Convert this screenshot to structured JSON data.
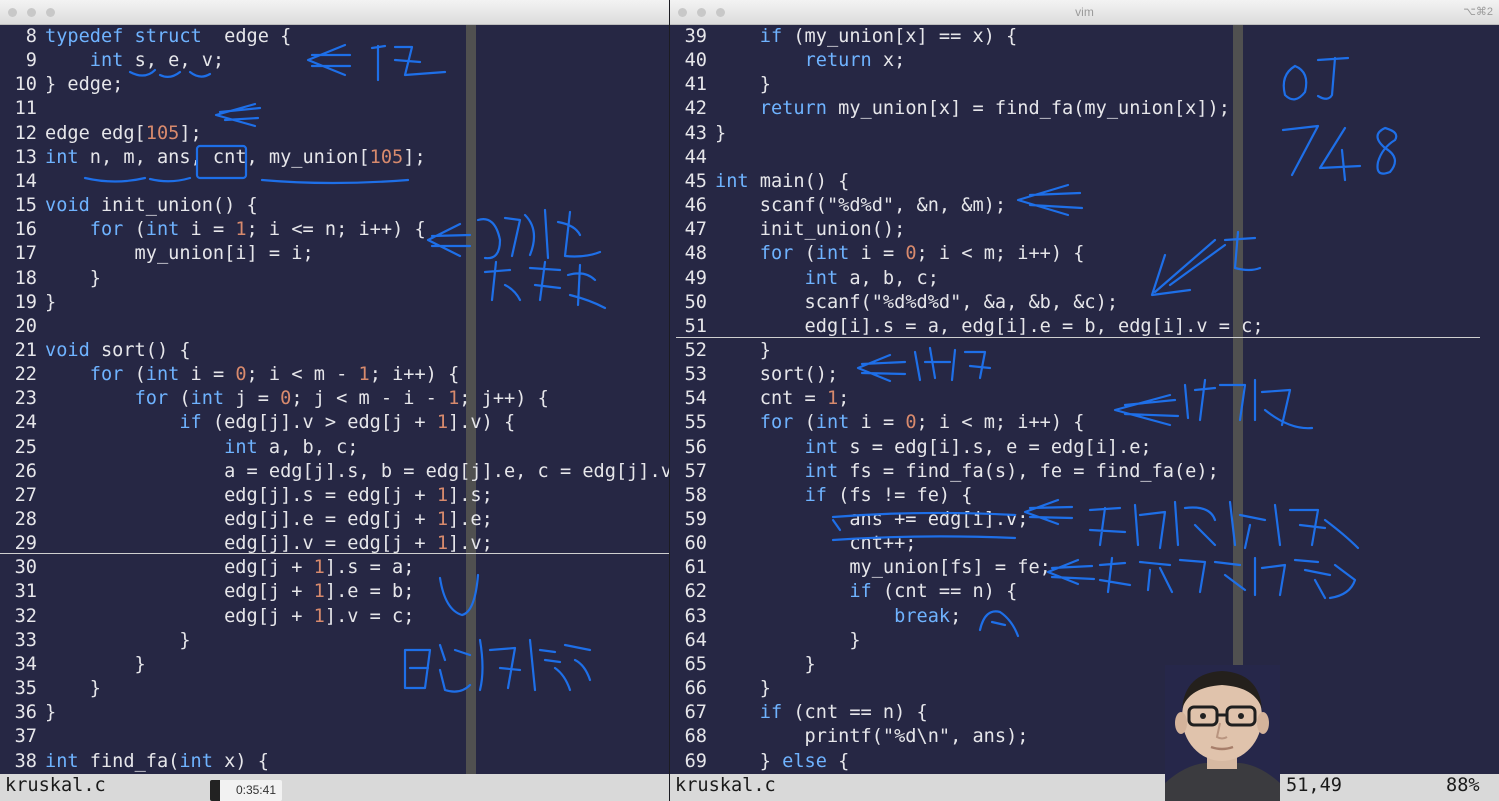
{
  "left_pane": {
    "status_file": "kruskal.c",
    "lines": [
      {
        "n": "8",
        "parts": [
          [
            "kw",
            "typedef struct"
          ],
          [
            "",
            "  edge {"
          ]
        ]
      },
      {
        "n": "9",
        "parts": [
          [
            "",
            "    "
          ],
          [
            "kw",
            "int"
          ],
          [
            "",
            " s, e, v;"
          ]
        ]
      },
      {
        "n": "10",
        "parts": [
          [
            "",
            "} edge;"
          ]
        ]
      },
      {
        "n": "11",
        "parts": []
      },
      {
        "n": "12",
        "parts": [
          [
            "",
            "edge edg["
          ],
          [
            "num",
            "105"
          ],
          [
            "",
            "];"
          ]
        ]
      },
      {
        "n": "13",
        "parts": [
          [
            "kw",
            "int"
          ],
          [
            "",
            " n, m, ans, cnt, my_union["
          ],
          [
            "num",
            "105"
          ],
          [
            "",
            "];"
          ]
        ]
      },
      {
        "n": "14",
        "parts": []
      },
      {
        "n": "15",
        "parts": [
          [
            "kw",
            "void"
          ],
          [
            "",
            " init_union() {"
          ]
        ]
      },
      {
        "n": "16",
        "parts": [
          [
            "",
            "    "
          ],
          [
            "kw",
            "for"
          ],
          [
            "",
            " ("
          ],
          [
            "kw",
            "int"
          ],
          [
            "",
            " i = "
          ],
          [
            "num",
            "1"
          ],
          [
            "",
            "; i <= n; i++) {"
          ]
        ]
      },
      {
        "n": "17",
        "parts": [
          [
            "",
            "        my_union[i] = i;"
          ]
        ]
      },
      {
        "n": "18",
        "parts": [
          [
            "",
            "    }"
          ]
        ]
      },
      {
        "n": "19",
        "parts": [
          [
            "",
            "}"
          ]
        ]
      },
      {
        "n": "20",
        "parts": []
      },
      {
        "n": "21",
        "parts": [
          [
            "kw",
            "void"
          ],
          [
            "",
            " sort() {"
          ]
        ]
      },
      {
        "n": "22",
        "parts": [
          [
            "",
            "    "
          ],
          [
            "kw",
            "for"
          ],
          [
            "",
            " ("
          ],
          [
            "kw",
            "int"
          ],
          [
            "",
            " i = "
          ],
          [
            "num",
            "0"
          ],
          [
            "",
            "; i < m - "
          ],
          [
            "num",
            "1"
          ],
          [
            "",
            "; i++) {"
          ]
        ]
      },
      {
        "n": "23",
        "parts": [
          [
            "",
            "        "
          ],
          [
            "kw",
            "for"
          ],
          [
            "",
            " ("
          ],
          [
            "kw",
            "int"
          ],
          [
            "",
            " j = "
          ],
          [
            "num",
            "0"
          ],
          [
            "",
            "; j < m - i - "
          ],
          [
            "num",
            "1"
          ],
          [
            "",
            "; j++) {"
          ]
        ]
      },
      {
        "n": "24",
        "parts": [
          [
            "",
            "            "
          ],
          [
            "kw",
            "if"
          ],
          [
            "",
            " (edg[j].v > edg[j + "
          ],
          [
            "num",
            "1"
          ],
          [
            "",
            "].v) {"
          ]
        ]
      },
      {
        "n": "25",
        "parts": [
          [
            "",
            "                "
          ],
          [
            "kw",
            "int"
          ],
          [
            "",
            " a, b, c;"
          ]
        ]
      },
      {
        "n": "26",
        "parts": [
          [
            "",
            "                a = edg[j].s, b = edg[j].e, c = edg[j].v;"
          ]
        ]
      },
      {
        "n": "27",
        "parts": [
          [
            "",
            "                edg[j].s = edg[j + "
          ],
          [
            "num",
            "1"
          ],
          [
            "",
            "].s;"
          ]
        ]
      },
      {
        "n": "28",
        "parts": [
          [
            "",
            "                edg[j].e = edg[j + "
          ],
          [
            "num",
            "1"
          ],
          [
            "",
            "].e;"
          ]
        ]
      },
      {
        "n": "29",
        "parts": [
          [
            "",
            "                edg[j].v = edg[j + "
          ],
          [
            "num",
            "1"
          ],
          [
            "",
            "].v;"
          ]
        ]
      },
      {
        "n": "30",
        "parts": [
          [
            "",
            "                edg[j + "
          ],
          [
            "num",
            "1"
          ],
          [
            "",
            "].s = a;"
          ]
        ]
      },
      {
        "n": "31",
        "parts": [
          [
            "",
            "                edg[j + "
          ],
          [
            "num",
            "1"
          ],
          [
            "",
            "].e = b;"
          ]
        ]
      },
      {
        "n": "32",
        "parts": [
          [
            "",
            "                edg[j + "
          ],
          [
            "num",
            "1"
          ],
          [
            "",
            "].v = c;"
          ]
        ]
      },
      {
        "n": "33",
        "parts": [
          [
            "",
            "            }"
          ]
        ]
      },
      {
        "n": "34",
        "parts": [
          [
            "",
            "        }"
          ]
        ]
      },
      {
        "n": "35",
        "parts": [
          [
            "",
            "    }"
          ]
        ]
      },
      {
        "n": "36",
        "parts": [
          [
            "",
            "}"
          ]
        ]
      },
      {
        "n": "37",
        "parts": []
      },
      {
        "n": "38",
        "parts": [
          [
            "kw",
            "int"
          ],
          [
            "",
            " find_fa("
          ],
          [
            "kw",
            "int"
          ],
          [
            "",
            " x) {"
          ]
        ]
      }
    ]
  },
  "right_pane": {
    "title": "vim",
    "shortcut": "⌥⌘2",
    "status_file": "kruskal.c",
    "status_position": "51,49",
    "status_percent": "88%",
    "lines": [
      {
        "n": "39",
        "parts": [
          [
            "",
            "    "
          ],
          [
            "kw",
            "if"
          ],
          [
            "",
            " (my_union[x] == x) {"
          ]
        ]
      },
      {
        "n": "40",
        "parts": [
          [
            "",
            "        "
          ],
          [
            "kw",
            "return"
          ],
          [
            "",
            " x;"
          ]
        ]
      },
      {
        "n": "41",
        "parts": [
          [
            "",
            "    }"
          ]
        ]
      },
      {
        "n": "42",
        "parts": [
          [
            "",
            "    "
          ],
          [
            "kw",
            "return"
          ],
          [
            "",
            " my_union[x] = find_fa(my_union[x]);"
          ]
        ]
      },
      {
        "n": "43",
        "parts": [
          [
            "",
            "}"
          ]
        ]
      },
      {
        "n": "44",
        "parts": []
      },
      {
        "n": "45",
        "parts": [
          [
            "kw",
            "int"
          ],
          [
            "",
            " main() {"
          ]
        ]
      },
      {
        "n": "46",
        "parts": [
          [
            "",
            "    scanf("
          ],
          [
            "str",
            "\"%d%d\""
          ],
          [
            "",
            ", &n, &m);"
          ]
        ]
      },
      {
        "n": "47",
        "parts": [
          [
            "",
            "    init_union();"
          ]
        ]
      },
      {
        "n": "48",
        "parts": [
          [
            "",
            "    "
          ],
          [
            "kw",
            "for"
          ],
          [
            "",
            " ("
          ],
          [
            "kw",
            "int"
          ],
          [
            "",
            " i = "
          ],
          [
            "num",
            "0"
          ],
          [
            "",
            "; i < m; i++) {"
          ]
        ]
      },
      {
        "n": "49",
        "parts": [
          [
            "",
            "        "
          ],
          [
            "kw",
            "int"
          ],
          [
            "",
            " a, b, c;"
          ]
        ]
      },
      {
        "n": "50",
        "parts": [
          [
            "",
            "        scanf("
          ],
          [
            "str",
            "\"%d%d%d\""
          ],
          [
            "",
            ", &a, &b, &c);"
          ]
        ]
      },
      {
        "n": "51",
        "parts": [
          [
            "",
            "        edg[i].s = a, edg[i].e = b, edg[i].v = c;"
          ]
        ]
      },
      {
        "n": "52",
        "parts": [
          [
            "",
            "    }"
          ]
        ]
      },
      {
        "n": "53",
        "parts": [
          [
            "",
            "    sort();"
          ]
        ]
      },
      {
        "n": "54",
        "parts": [
          [
            "",
            "    cnt = "
          ],
          [
            "num",
            "1"
          ],
          [
            "",
            ";"
          ]
        ]
      },
      {
        "n": "55",
        "parts": [
          [
            "",
            "    "
          ],
          [
            "kw",
            "for"
          ],
          [
            "",
            " ("
          ],
          [
            "kw",
            "int"
          ],
          [
            "",
            " i = "
          ],
          [
            "num",
            "0"
          ],
          [
            "",
            "; i < m; i++) {"
          ]
        ]
      },
      {
        "n": "56",
        "parts": [
          [
            "",
            "        "
          ],
          [
            "kw",
            "int"
          ],
          [
            "",
            " s = edg[i].s, e = edg[i].e;"
          ]
        ]
      },
      {
        "n": "57",
        "parts": [
          [
            "",
            "        "
          ],
          [
            "kw",
            "int"
          ],
          [
            "",
            " fs = find_fa(s), fe = find_fa(e);"
          ]
        ]
      },
      {
        "n": "58",
        "parts": [
          [
            "",
            "        "
          ],
          [
            "kw",
            "if"
          ],
          [
            "",
            " (fs != fe) {"
          ]
        ]
      },
      {
        "n": "59",
        "parts": [
          [
            "",
            "            ans += edg[i].v;"
          ]
        ]
      },
      {
        "n": "60",
        "parts": [
          [
            "",
            "            cnt++;"
          ]
        ]
      },
      {
        "n": "61",
        "parts": [
          [
            "",
            "            my_union[fs] = fe;"
          ]
        ]
      },
      {
        "n": "62",
        "parts": [
          [
            "",
            "            "
          ],
          [
            "kw",
            "if"
          ],
          [
            "",
            " (cnt == n) {"
          ]
        ]
      },
      {
        "n": "63",
        "parts": [
          [
            "",
            "                "
          ],
          [
            "kw",
            "break"
          ],
          [
            "",
            ";"
          ]
        ]
      },
      {
        "n": "64",
        "parts": [
          [
            "",
            "            }"
          ]
        ]
      },
      {
        "n": "65",
        "parts": [
          [
            "",
            "        }"
          ]
        ]
      },
      {
        "n": "66",
        "parts": [
          [
            "",
            "    }"
          ]
        ]
      },
      {
        "n": "67",
        "parts": [
          [
            "",
            "    "
          ],
          [
            "kw",
            "if"
          ],
          [
            "",
            " (cnt == n) {"
          ]
        ]
      },
      {
        "n": "68",
        "parts": [
          [
            "",
            "        printf("
          ],
          [
            "str",
            "\"%d\\n\""
          ],
          [
            "",
            ", ans);"
          ]
        ]
      },
      {
        "n": "69",
        "parts": [
          [
            "",
            "    } "
          ],
          [
            "kw",
            "else"
          ],
          [
            "",
            " {"
          ]
        ]
      }
    ]
  },
  "video": {
    "timestamp": "0:35:41"
  },
  "colors": {
    "background": "#262744",
    "keyword": "#6fb3ff",
    "number": "#d88a6d",
    "text": "#e6e6ea",
    "ink": "#1e6fe8"
  }
}
